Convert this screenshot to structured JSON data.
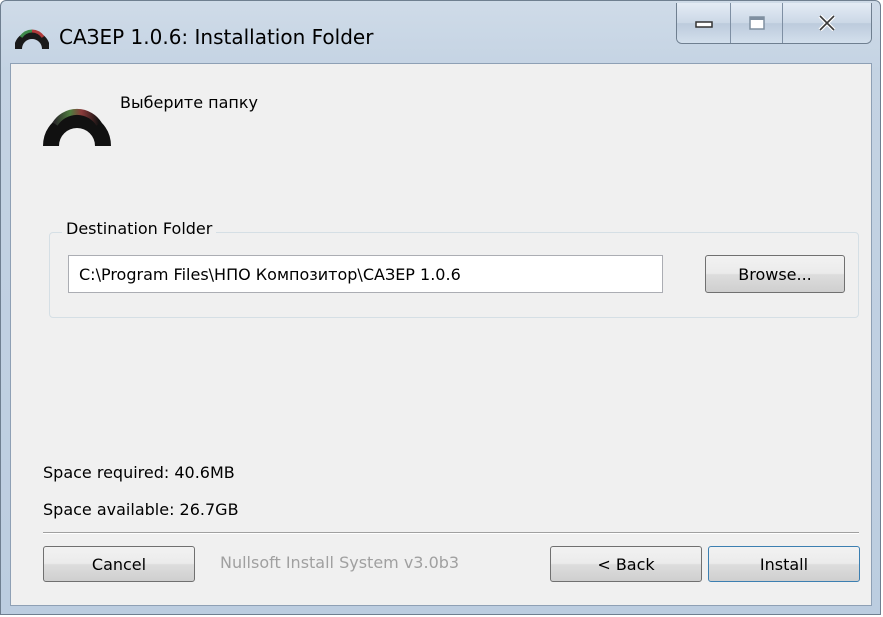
{
  "window": {
    "title": "САЗЕР 1.0.6: Installation Folder",
    "app_icon": "arc-logo-icon"
  },
  "caption_buttons": {
    "minimize_icon": "minimize-icon",
    "maximize_icon": "maximize-icon",
    "close_icon": "close-icon"
  },
  "header": {
    "title": "Выберите папку",
    "icon": "arc-logo-icon"
  },
  "destination": {
    "group_label": "Destination Folder",
    "path": "C:\\Program Files\\НПО Композитор\\САЗЕР 1.0.6",
    "browse_label": "Browse..."
  },
  "space": {
    "required": "Space required: 40.6MB",
    "available": "Space available: 26.7GB"
  },
  "footer": {
    "branding": "Nullsoft Install System v3.0b3",
    "cancel_label": "Cancel",
    "back_label": "< Back",
    "install_label": "Install"
  },
  "colors": {
    "title_gradient_top": "#cfdbe8",
    "panel_background": "#f0f0f0",
    "default_button_border": "#3c7fb1"
  }
}
